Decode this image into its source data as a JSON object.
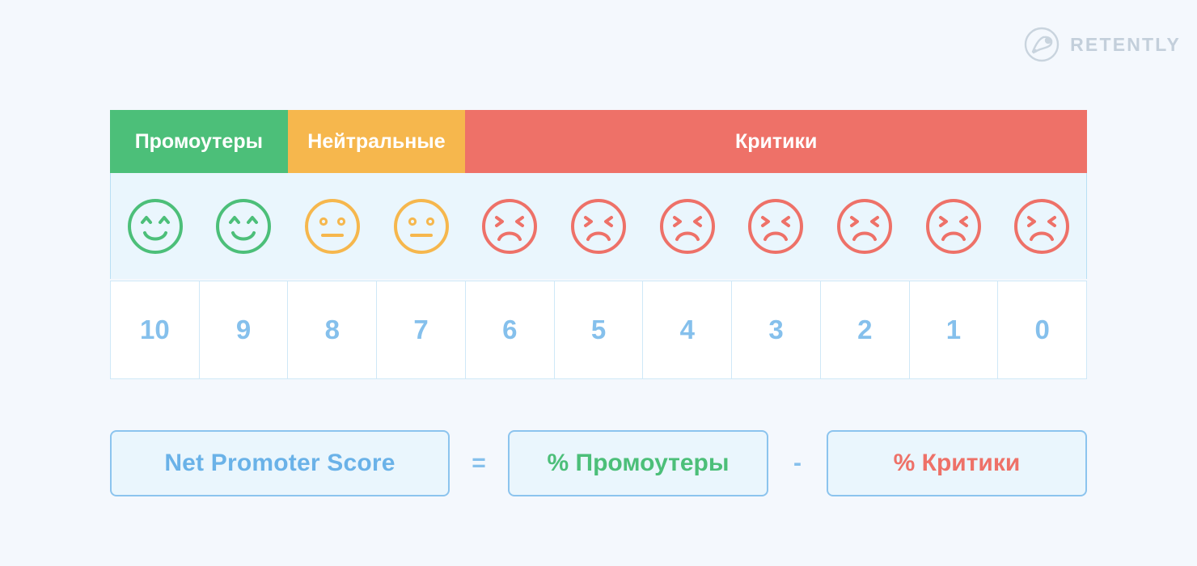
{
  "brand": {
    "name": "RETENTLY",
    "logo_icon": "retently-circle-swoosh-icon",
    "logo_color": "#c3cfdb"
  },
  "scale": {
    "segments": [
      {
        "key": "promoters",
        "label": "Промоутеры",
        "color": "#4cbf79",
        "span": 2,
        "face": "happy"
      },
      {
        "key": "passives",
        "label": "Нейтральные",
        "color": "#f6b74d",
        "span": 2,
        "face": "neutral"
      },
      {
        "key": "detractors",
        "label": "Критики",
        "color": "#ee7168",
        "span": 7,
        "face": "sad"
      }
    ],
    "faces": [
      {
        "type": "happy",
        "color": "#4cbf79",
        "icon": "happy-face-icon"
      },
      {
        "type": "happy",
        "color": "#4cbf79",
        "icon": "happy-face-icon"
      },
      {
        "type": "neutral",
        "color": "#f6b74d",
        "icon": "neutral-face-icon"
      },
      {
        "type": "neutral",
        "color": "#f6b74d",
        "icon": "neutral-face-icon"
      },
      {
        "type": "sad",
        "color": "#ee7168",
        "icon": "sad-face-icon"
      },
      {
        "type": "sad",
        "color": "#ee7168",
        "icon": "sad-face-icon"
      },
      {
        "type": "sad",
        "color": "#ee7168",
        "icon": "sad-face-icon"
      },
      {
        "type": "sad",
        "color": "#ee7168",
        "icon": "sad-face-icon"
      },
      {
        "type": "sad",
        "color": "#ee7168",
        "icon": "sad-face-icon"
      },
      {
        "type": "sad",
        "color": "#ee7168",
        "icon": "sad-face-icon"
      },
      {
        "type": "sad",
        "color": "#ee7168",
        "icon": "sad-face-icon"
      }
    ],
    "numbers": [
      "10",
      "9",
      "8",
      "7",
      "6",
      "5",
      "4",
      "3",
      "2",
      "1",
      "0"
    ],
    "number_color": "#85c0ec"
  },
  "formula": {
    "result_label": "Net Promoter Score",
    "equals_sign": "=",
    "minus_sign": "-",
    "promoters_label": "% Промоутеры",
    "detractors_label": "% Критики",
    "result_color": "#6ab2e8",
    "promoters_color": "#4cbf79",
    "detractors_color": "#ee7168"
  }
}
